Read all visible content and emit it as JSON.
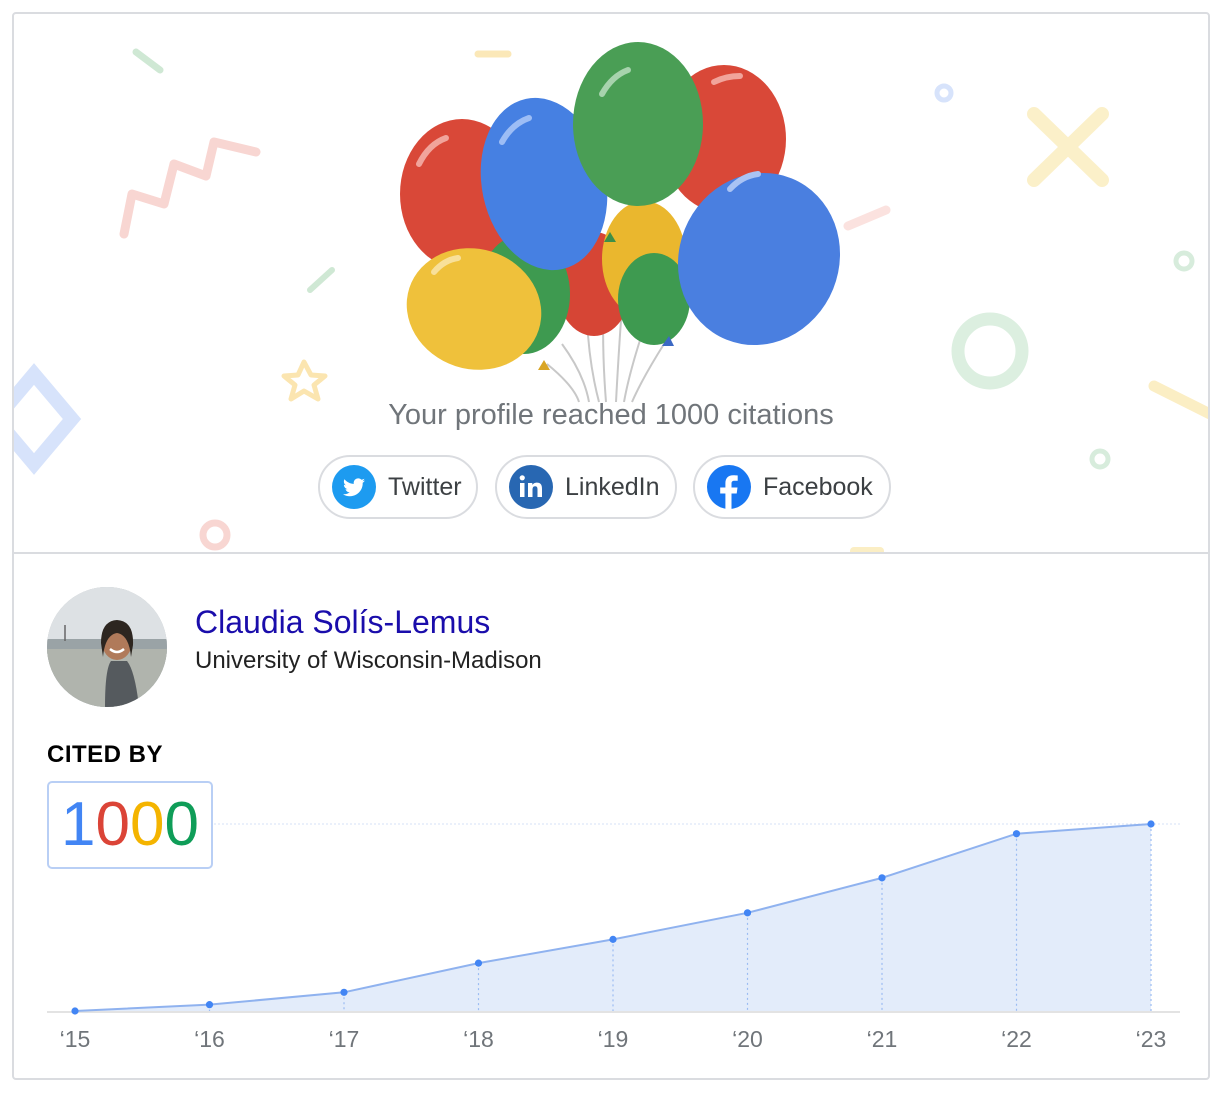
{
  "banner": {
    "headline": "Your profile reached 1000 citations",
    "share_buttons": [
      {
        "label": "Twitter",
        "icon": "twitter-icon",
        "color": "#1d9bf0"
      },
      {
        "label": "LinkedIn",
        "icon": "linkedin-icon",
        "color": "#2867b2"
      },
      {
        "label": "Facebook",
        "icon": "facebook-icon",
        "color": "#1877f2"
      }
    ],
    "balloon_colors": [
      "#db4437",
      "#4285f4",
      "#0f9d58",
      "#f4b400"
    ]
  },
  "profile": {
    "name": "Claudia Solís-Lemus",
    "affiliation": "University of Wisconsin-Madison",
    "cited_by_label": "CITED BY",
    "citation_count_digits": [
      "1",
      "0",
      "0",
      "0"
    ],
    "digit_colors": [
      "#4285f4",
      "#db4437",
      "#f4b400",
      "#0f9d58"
    ]
  },
  "chart_data": {
    "type": "area",
    "categories": [
      "‘15",
      "‘16",
      "‘17",
      "‘18",
      "‘19",
      "‘20",
      "‘21",
      "‘22",
      "‘23"
    ],
    "values": [
      0,
      34,
      100,
      256,
      383,
      525,
      712,
      948,
      1000
    ],
    "ylim": [
      0,
      1000
    ],
    "line_color": "#4285f4",
    "fill_color": "#e3ecfa"
  }
}
